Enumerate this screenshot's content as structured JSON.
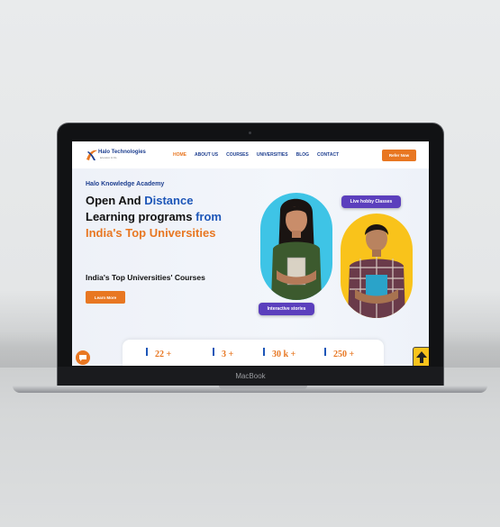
{
  "laptop": {
    "model_label": "MacBook"
  },
  "nav": {
    "logo_text": "Halo Technologies",
    "logo_sub": "Education for life",
    "items": [
      {
        "label": "HOME",
        "active": true
      },
      {
        "label": "ABOUT US",
        "active": false
      },
      {
        "label": "COURSES",
        "active": false
      },
      {
        "label": "UNIVERSITIES",
        "active": false
      },
      {
        "label": "BLOG",
        "active": false
      },
      {
        "label": "CONTACT",
        "active": false
      }
    ],
    "cta_label": "Refer Now"
  },
  "hero": {
    "academy": "Halo Knowledge Academy",
    "headline": {
      "part1": "Open And ",
      "part2": "Distance",
      "part3": "Learning programs ",
      "part4": "from",
      "part5": "India's Top Universities"
    },
    "subhead": "India's Top Universities' Courses",
    "button_label": "Learn More",
    "badge_live": "Live hobby Classes",
    "badge_interactive": "Interactive stories"
  },
  "stats": [
    {
      "value": "22 +"
    },
    {
      "value": "3 +"
    },
    {
      "value": "30 k +"
    },
    {
      "value": "250 +"
    }
  ],
  "colors": {
    "accent": "#e87722",
    "brand": "#1d56b8",
    "navy": "#1d3e8f",
    "badge": "#5b3fbd"
  },
  "icons": {
    "chat": "chat-icon",
    "back_to_top": "arrow-up-icon"
  }
}
